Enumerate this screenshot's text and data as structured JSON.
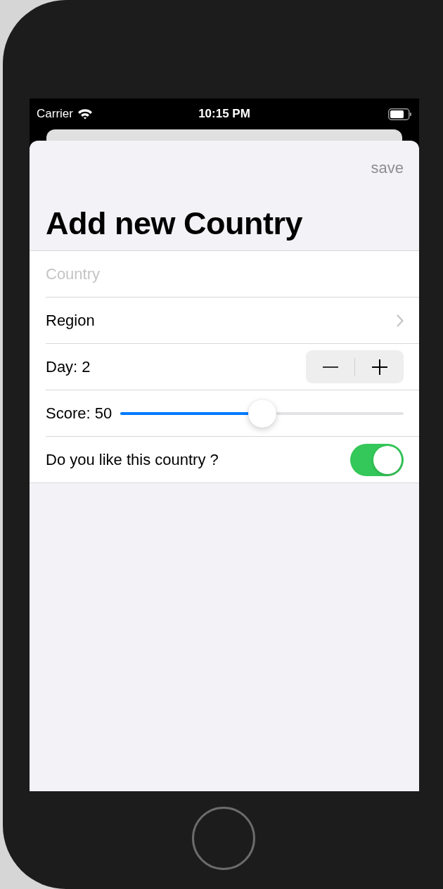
{
  "status_bar": {
    "carrier": "Carrier",
    "time": "10:15 PM"
  },
  "sheet": {
    "action": "save",
    "title": "Add new Country"
  },
  "form": [
    {
      "kind": "text_field",
      "placeholder": "Country"
    },
    {
      "kind": "navigation",
      "label": "Region"
    },
    {
      "kind": "stepper",
      "label": "Day: 2"
    },
    {
      "kind": "slider",
      "label": "Score: 50",
      "level": 0.5
    },
    {
      "kind": "toggle",
      "label": "Do you like this country ?",
      "on": true
    }
  ]
}
